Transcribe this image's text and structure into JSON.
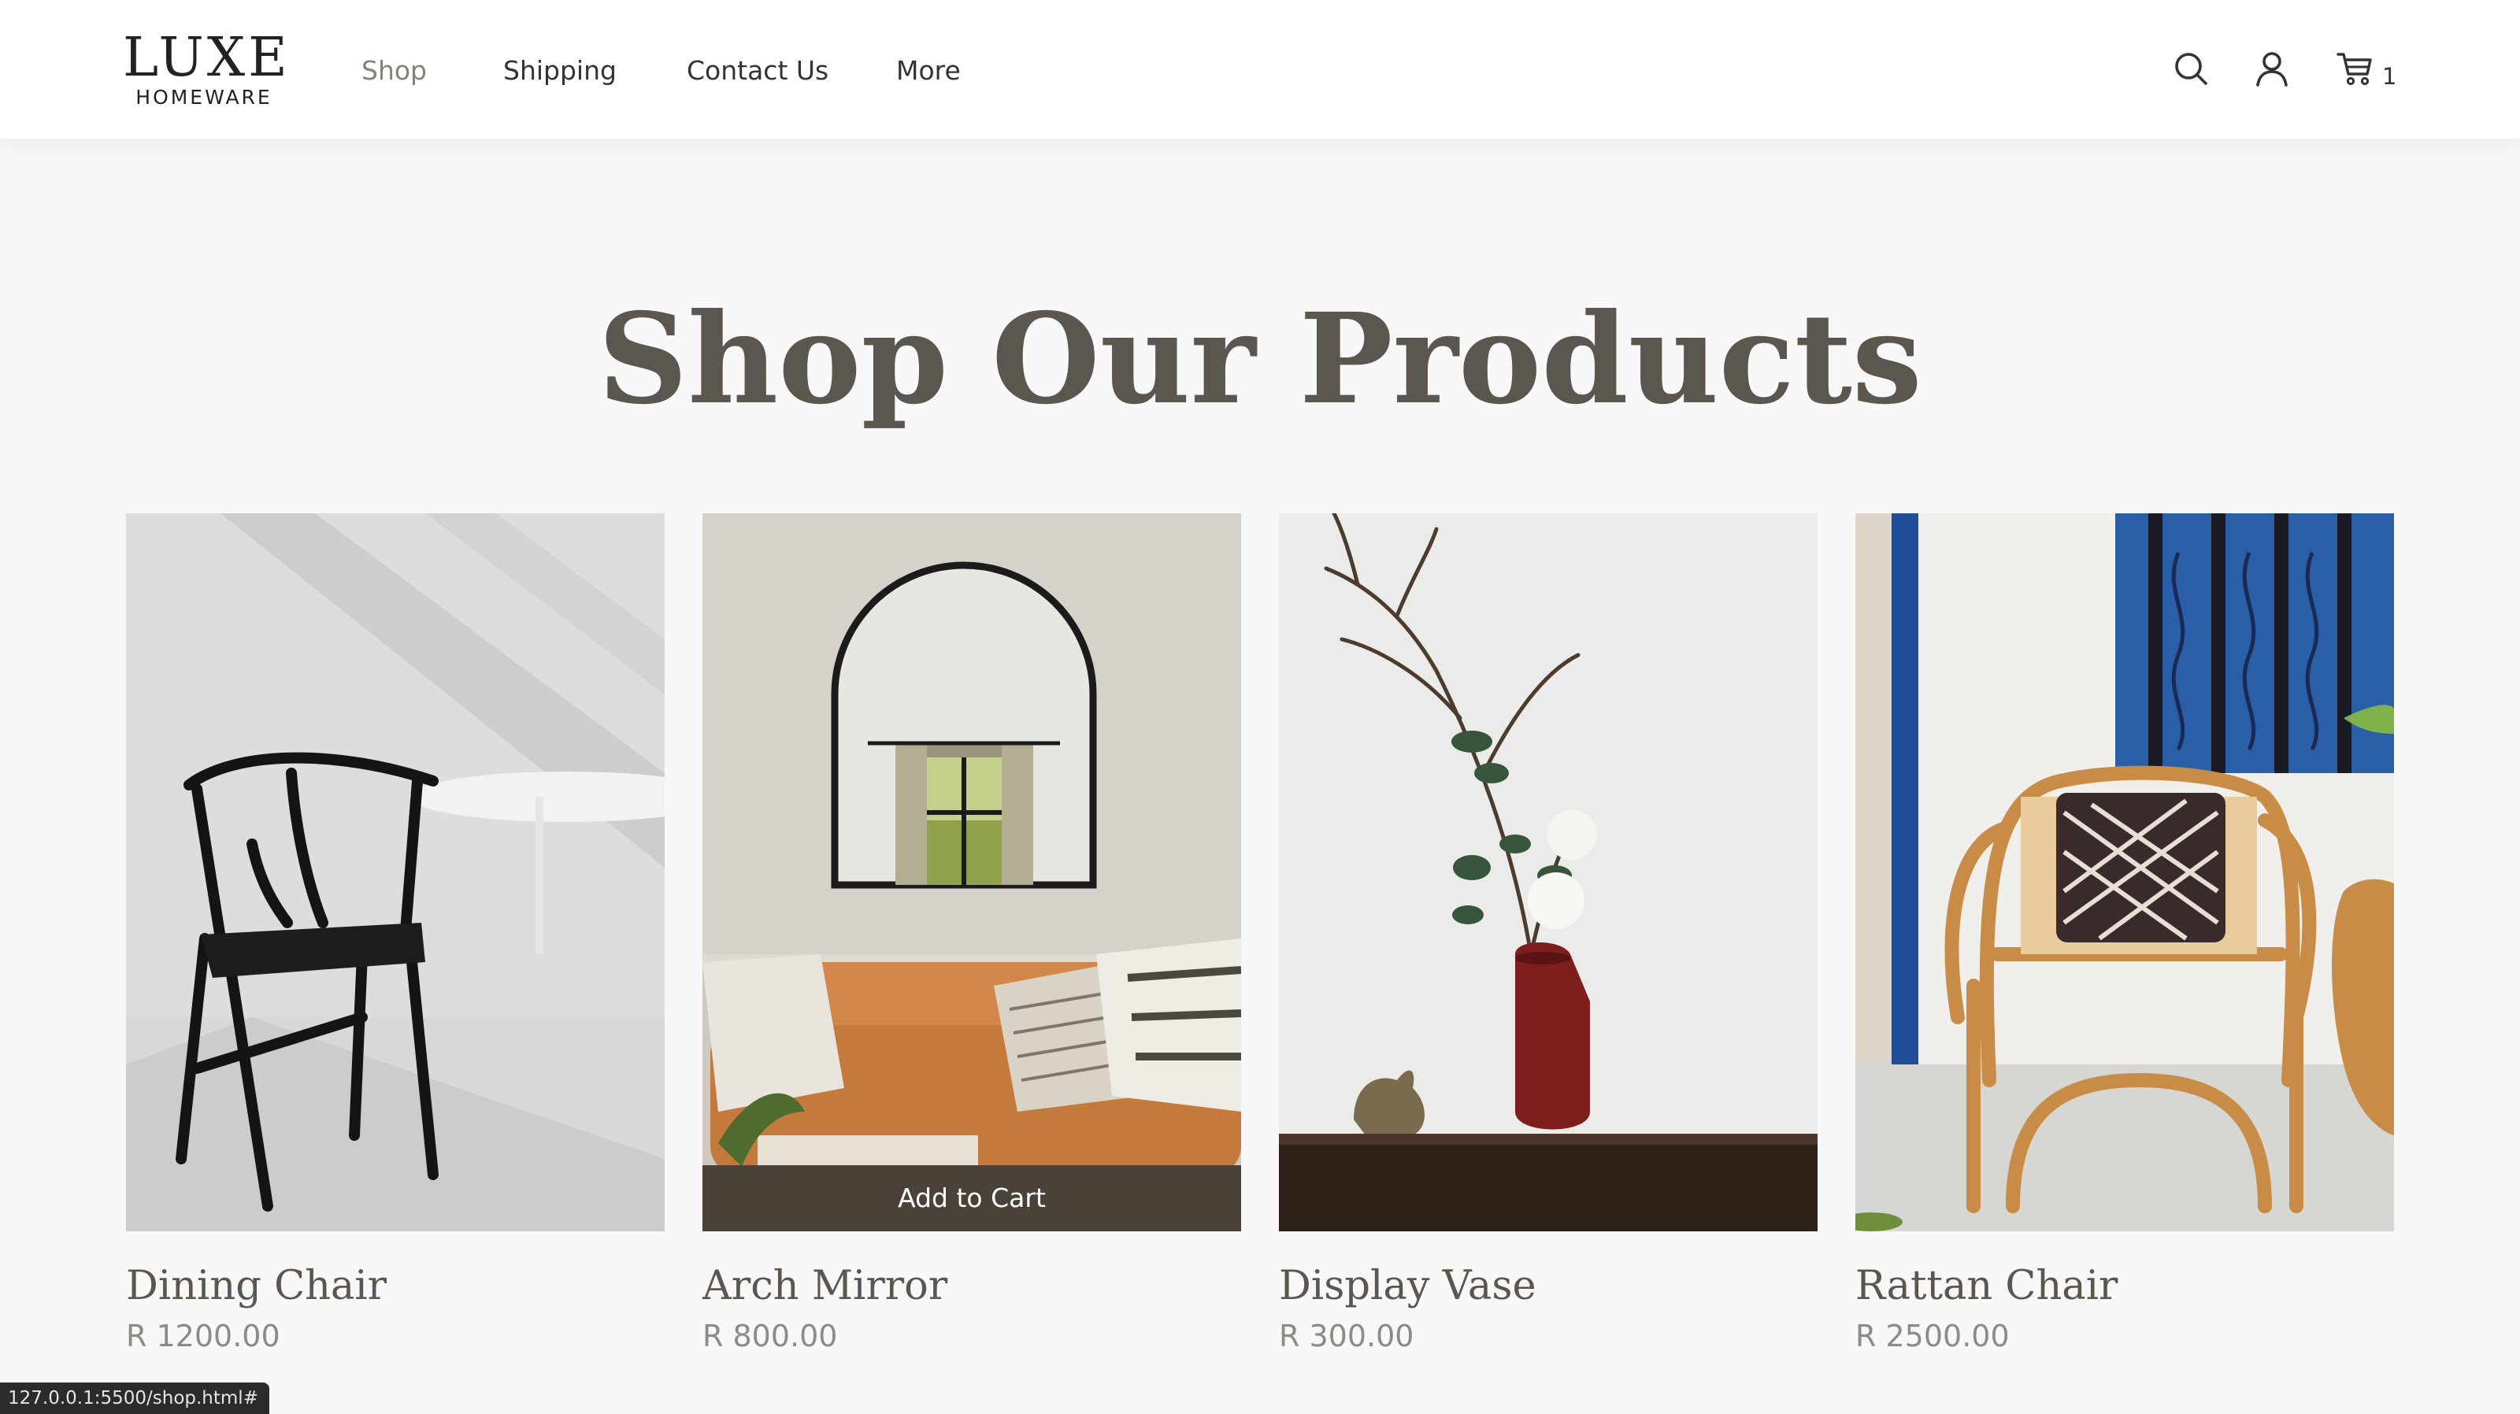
{
  "brand": {
    "name": "LUXE",
    "tagline": "HOMEWARE"
  },
  "nav": {
    "items": [
      {
        "label": "Shop",
        "active": true
      },
      {
        "label": "Shipping",
        "active": false
      },
      {
        "label": "Contact Us",
        "active": false
      },
      {
        "label": "More",
        "active": false
      }
    ]
  },
  "header_icons": {
    "search": "search-icon",
    "account": "user-icon",
    "cart": "cart-icon"
  },
  "cart": {
    "count": "1"
  },
  "page": {
    "title": "Shop Our Products"
  },
  "products": [
    {
      "name": "Dining Chair",
      "price": "R 1200.00"
    },
    {
      "name": "Arch Mirror",
      "price": "R 800.00",
      "hover_action": "Add to Cart"
    },
    {
      "name": "Display Vase",
      "price": "R 300.00"
    },
    {
      "name": "Rattan Chair",
      "price": "R 2500.00"
    }
  ],
  "status_bar": {
    "url": "127.0.0.1:5500/shop.html#"
  },
  "colors": {
    "background": "#f8f8f8",
    "heading": "#5b564f",
    "price": "#8e8a85",
    "nav_active": "#8a8176",
    "add_to_cart_bg": "#4a4138"
  }
}
